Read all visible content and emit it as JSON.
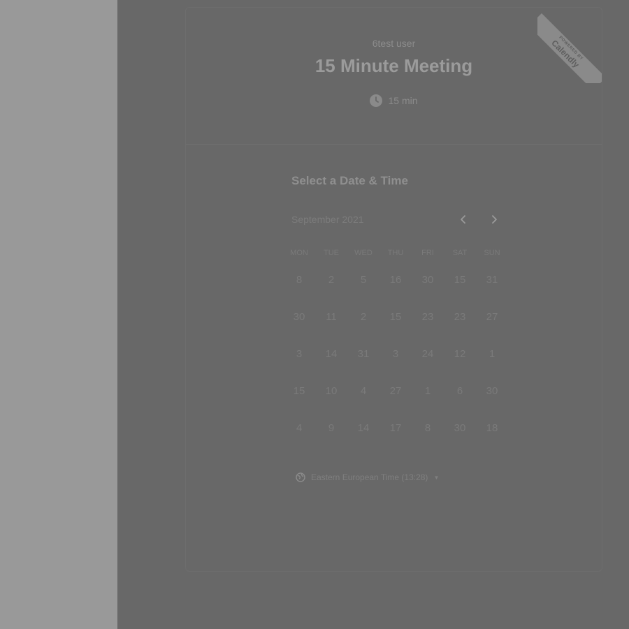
{
  "event": {
    "owner": "6test user",
    "title": "15 Minute Meeting",
    "duration": "15 min"
  },
  "badge": {
    "top_text": "POWERED BY",
    "brand": "Calendly"
  },
  "scheduler": {
    "section_title": "Select a Date & Time",
    "month": "September 2021",
    "weekdays": [
      "MON",
      "TUE",
      "WED",
      "THU",
      "FRI",
      "SAT",
      "SUN"
    ],
    "weeks": [
      [
        "8",
        "2",
        "5",
        "16",
        "30",
        "15",
        "31"
      ],
      [
        "30",
        "11",
        "2",
        "15",
        "23",
        "23",
        "27"
      ],
      [
        "3",
        "14",
        "31",
        "3",
        "24",
        "12",
        "1"
      ],
      [
        "15",
        "10",
        "4",
        "27",
        "1",
        "6",
        "30"
      ],
      [
        "4",
        "9",
        "14",
        "17",
        "8",
        "30",
        "18"
      ]
    ],
    "timezone": "Eastern European Time (13:28)"
  },
  "icons": {
    "clock": "clock-icon",
    "prev": "chevron-left-icon",
    "next": "chevron-right-icon",
    "globe": "globe-icon",
    "caret": "caret-down-icon"
  },
  "colors": {
    "overlay": "#686868",
    "left_pane": "#999999"
  }
}
